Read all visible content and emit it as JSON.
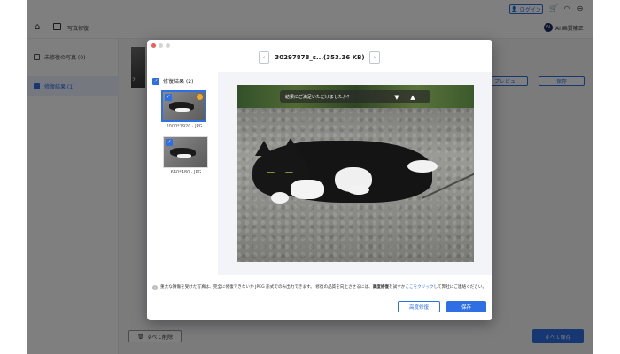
{
  "app": {
    "header_title": "写真修復",
    "login_label": "ログイン",
    "ai_label": "AI 画質補正"
  },
  "sidebar": {
    "items": [
      {
        "label": "未修復の写真 (0)"
      },
      {
        "label": "修復結果 (1)"
      }
    ]
  },
  "background": {
    "thumb_count": "2",
    "preview_label": "プレビュー",
    "save_label": "保存",
    "delete_all_label": "すべて削除",
    "save_all_label": "すべて保存"
  },
  "dialog": {
    "file_title": "30297878_s...(353.36 KB)",
    "prev_icon": "chevron-left-icon",
    "next_icon": "chevron-right-icon",
    "results_header": "修復結果 (2)",
    "thumbnails": [
      {
        "label": "2000*1920 · JPG",
        "selected": true
      },
      {
        "label": "640*480 · JPG",
        "selected": false
      }
    ],
    "feedback_text": "結果にご満足いただけましたか？",
    "note_before_bold": "重大な損傷を受けた写真は、完全に修復できないか JPEG 形式でのみ出力できます。 修復の品質を向上させるには、",
    "note_bold": "高度修復",
    "note_mid": "を試すか",
    "note_link": "ここをクリック",
    "note_after": "して弊社にご連絡ください。",
    "advanced_button": "高度修復",
    "save_button": "保存"
  },
  "colors": {
    "accent": "#2f6fe4",
    "overlay": "rgba(0,0,0,0.5)"
  }
}
